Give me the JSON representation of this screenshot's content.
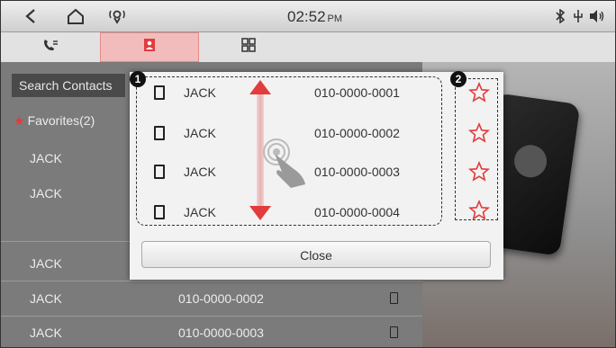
{
  "status_bar": {
    "time": "02:52",
    "ampm": "PM",
    "icons": [
      "back-icon",
      "home-icon",
      "voice-recognition-icon",
      "bluetooth-icon",
      "usb-icon",
      "volume-icon"
    ]
  },
  "tabs": [
    {
      "icon": "call-history-icon",
      "active": false
    },
    {
      "icon": "contacts-icon",
      "active": true
    },
    {
      "icon": "keypad-icon",
      "active": false
    }
  ],
  "contacts_list": {
    "search_placeholder": "Search Contacts",
    "favorites_label": "Favorites(2)",
    "rows": [
      {
        "name": "JACK",
        "number": ""
      },
      {
        "name": "JACK",
        "number": ""
      },
      {
        "name": "JACK",
        "number": ""
      },
      {
        "name": "JACK",
        "number": "010-0000-0002"
      },
      {
        "name": "JACK",
        "number": "010-0000-0003"
      }
    ]
  },
  "popup": {
    "badge_1": "1",
    "badge_2": "2",
    "entries": [
      {
        "name": "JACK",
        "number": "010-0000-0001",
        "favorite": false
      },
      {
        "name": "JACK",
        "number": "010-0000-0002",
        "favorite": false
      },
      {
        "name": "JACK",
        "number": "010-0000-0003",
        "favorite": false
      },
      {
        "name": "JACK",
        "number": "010-0000-0004",
        "favorite": false
      }
    ],
    "close_label": "Close"
  },
  "colors": {
    "accent_red": "#e23c3c",
    "tab_active": "#f3bcbc"
  }
}
